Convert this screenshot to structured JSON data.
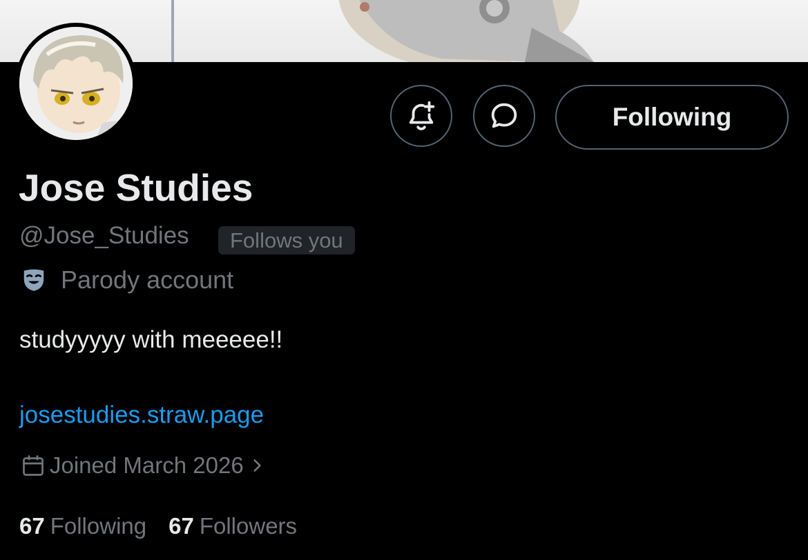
{
  "profile": {
    "name": "Jose Studies",
    "handle": "@Jose_Studies",
    "follows_you_badge": "Follows you",
    "parody_label": "Parody account",
    "bio": "studyyyyy with meeeee!!",
    "website": "josestudies.straw.page",
    "joined": "Joined March 2026"
  },
  "actions": {
    "following_label": "Following",
    "notify_icon": "bell-plus-icon",
    "message_icon": "message-bubble-icon"
  },
  "stats": {
    "following_count": "67",
    "following_label": "Following",
    "followers_count": "67",
    "followers_label": "Followers"
  },
  "colors": {
    "background": "#000000",
    "primary_text": "#e7e9ea",
    "secondary_text": "#71767b",
    "link": "#1d9bf0",
    "button_border": "#536471"
  }
}
